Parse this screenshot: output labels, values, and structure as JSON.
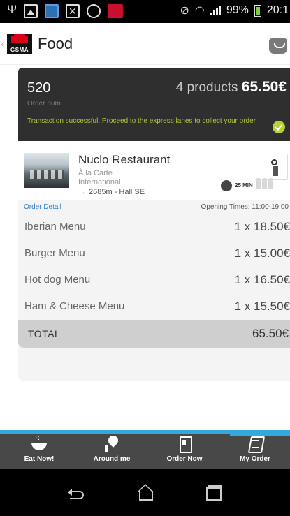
{
  "status_bar": {
    "battery": "99%",
    "time": "20:1",
    "icons": [
      "usb-icon",
      "image-icon",
      "keyboard-icon",
      "mail-icon",
      "whatsapp-icon",
      "gsma-icon",
      "mute-icon",
      "wifi-icon",
      "signal-icon",
      "battery-icon"
    ]
  },
  "header": {
    "title": "Food",
    "logo_text": "GSMA",
    "basket_icon": "basket-icon"
  },
  "order": {
    "number": "520",
    "number_label": "Order num",
    "products": "4 products",
    "total": "65.50€",
    "message": "Transaction successful. Proceed to the express lanes to collect your order",
    "status_color": "#b9cf32"
  },
  "restaurant": {
    "name": "Nuclo Restaurant",
    "type": "À la Carte",
    "cuisine": "International",
    "distance": "2685m - Hall SE",
    "wait_label": "25 MIN"
  },
  "detail": {
    "title": "Order Detail",
    "opening_times": "Opening Times: 11:00-19:00"
  },
  "items": [
    {
      "name": "Iberian Menu",
      "qty": "1 x 18.50€"
    },
    {
      "name": "Burger Menu",
      "qty": "1 x 15.00€"
    },
    {
      "name": "Hot dog Menu",
      "qty": "1 x 16.50€"
    },
    {
      "name": "Ham & Cheese Menu",
      "qty": "1 x 15.50€"
    }
  ],
  "total": {
    "label": "TOTAL",
    "value": "65.50€"
  },
  "nav": {
    "items": [
      {
        "label": "Eat Now!",
        "icon": "bowl-icon"
      },
      {
        "label": "Around me",
        "icon": "location-icon"
      },
      {
        "label": "Order Now",
        "icon": "door-icon"
      },
      {
        "label": "My Order",
        "icon": "order-list-icon"
      }
    ],
    "active": "My Order",
    "accent_color": "#35a9dc"
  },
  "system_nav": {
    "icons": [
      "back-icon",
      "home-icon",
      "recent-apps-icon"
    ]
  }
}
